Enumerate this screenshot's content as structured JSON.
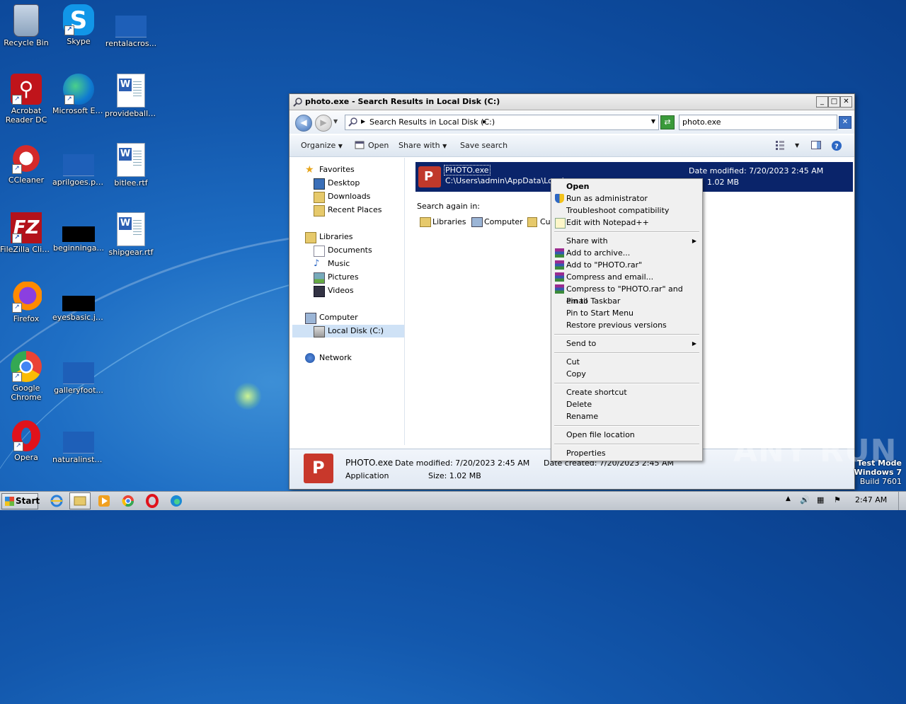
{
  "desktop": {
    "icons": [
      {
        "label": "Recycle Bin"
      },
      {
        "label": "Skype"
      },
      {
        "label": "rentalacros..."
      },
      {
        "label": "Acrobat Reader DC"
      },
      {
        "label": "Microsoft Edge"
      },
      {
        "label": "provideball.rtf"
      },
      {
        "label": "CCleaner"
      },
      {
        "label": "aprilgoes.png"
      },
      {
        "label": "bitlee.rtf"
      },
      {
        "label": "FileZilla Client"
      },
      {
        "label": "beginninga..."
      },
      {
        "label": "shipgear.rtf"
      },
      {
        "label": "Firefox"
      },
      {
        "label": "eyesbasic.jpg"
      },
      {
        "label": "Google Chrome"
      },
      {
        "label": "galleryfoot..."
      },
      {
        "label": "Opera"
      },
      {
        "label": "naturalinste..."
      }
    ]
  },
  "window": {
    "title": "photo.exe - Search Results in Local Disk (C:)",
    "controls": {
      "min": "_",
      "max": "□",
      "close": "✕"
    },
    "address": "Search Results in Local Disk (C:)",
    "search_value": "photo.exe",
    "toolbar": {
      "organize": "Organize",
      "open": "Open",
      "share_with": "Share with",
      "save_search": "Save search"
    },
    "nav": {
      "favorites": "Favorites",
      "desktop": "Desktop",
      "downloads": "Downloads",
      "recent": "Recent Places",
      "libraries": "Libraries",
      "documents": "Documents",
      "music": "Music",
      "pictures": "Pictures",
      "videos": "Videos",
      "computer": "Computer",
      "local_disk": "Local Disk (C:)",
      "network": "Network"
    },
    "result": {
      "name": "PHOTO.exe",
      "path": "C:\\Users\\admin\\AppData\\Local",
      "date_modified": "Date modified: 7/20/2023 2:45 AM",
      "size": "1.02 MB"
    },
    "search_again": {
      "label": "Search again in:",
      "libraries": "Libraries",
      "computer": "Computer",
      "custom": "Cus"
    },
    "details": {
      "name": "PHOTO.exe",
      "date_modified": "Date modified: 7/20/2023 2:45 AM",
      "date_created": "Date created: 7/20/2023 2:45 AM",
      "type": "Application",
      "size": "Size: 1.02 MB"
    }
  },
  "context_menu": {
    "open": "Open",
    "run_admin": "Run as administrator",
    "troubleshoot": "Troubleshoot compatibility",
    "edit_npp": "Edit with Notepad++",
    "share_with": "Share with",
    "add_archive": "Add to archive...",
    "add_rar": "Add to \"PHOTO.rar\"",
    "compress_email": "Compress and email...",
    "compress_rar_email": "Compress to \"PHOTO.rar\" and email",
    "pin_taskbar": "Pin to Taskbar",
    "pin_start": "Pin to Start Menu",
    "restore": "Restore previous versions",
    "send_to": "Send to",
    "cut": "Cut",
    "copy": "Copy",
    "create_shortcut": "Create shortcut",
    "delete": "Delete",
    "rename": "Rename",
    "open_location": "Open file location",
    "properties": "Properties"
  },
  "taskbar": {
    "start": "Start",
    "clock": "2:47 AM"
  },
  "watermark": "ANY RUN",
  "testmode": {
    "line1": "Test Mode",
    "line2": "Windows 7",
    "line3": "Build 7601"
  }
}
